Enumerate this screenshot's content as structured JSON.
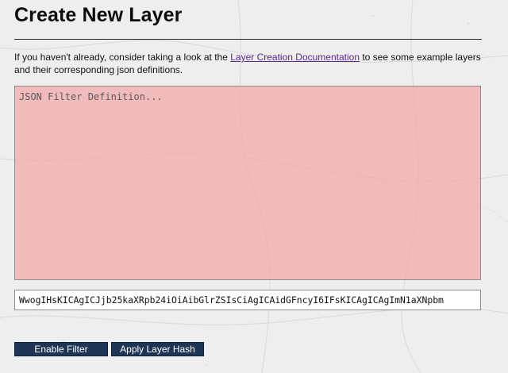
{
  "page": {
    "title": "Create New Layer"
  },
  "intro": {
    "text_before": "If you haven't already, consider taking a look at the ",
    "link_text": "Layer Creation Documentation",
    "text_after": " to see some example layers and their corresponding json definitions."
  },
  "filter_editor": {
    "placeholder": "JSON Filter Definition...",
    "value": ""
  },
  "hash_field": {
    "value": "WwogIHsKICAgICJjb25kaXRpb24iOiAibGlrZSIsCiAgICAidGFncyI6IFsKICAgICAgImN1aXNpbm"
  },
  "buttons": {
    "enable_filter": "Enable Filter",
    "apply_hash": "Apply Layer Hash"
  },
  "colors": {
    "editor_background": "#f2a8a8",
    "button_background": "#1e3556",
    "link": "#5b2a8c",
    "map_background": "#eeeeee"
  }
}
